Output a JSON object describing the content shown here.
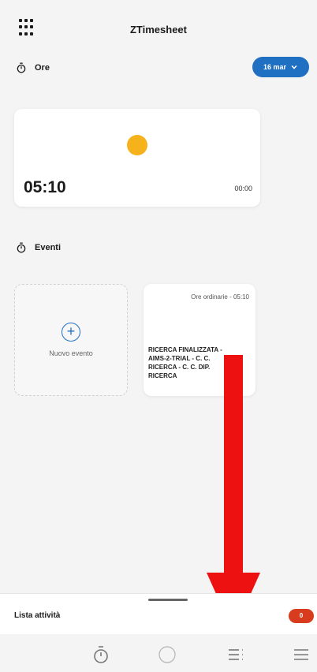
{
  "header": {
    "title": "ZTimesheet",
    "menu_icon": "grid-icon"
  },
  "hours_section": {
    "label": "Ore",
    "icon": "stopwatch-icon",
    "date_selector": {
      "label": "16 mar",
      "icon": "chevron-down-icon"
    }
  },
  "hours_card": {
    "total": "05:10",
    "secondary": "00:00",
    "indicator_color": "#f6b21b"
  },
  "events_section": {
    "label": "Eventi",
    "icon": "stopwatch-icon"
  },
  "new_event": {
    "label": "Nuovo evento",
    "icon": "plus-circle-icon"
  },
  "event_card": {
    "type": "Ore ordinarie - 05:10",
    "description": "RICERCA FINALIZZATA -\nAIMS-2-TRIAL - C. C.\nRICERCA - C. C. DIP.\nRICERCA"
  },
  "activity_sheet": {
    "label": "Lista attività",
    "count": "0"
  },
  "tabbar": {
    "items": [
      {
        "icon": "stopwatch-icon"
      },
      {
        "icon": "circle-icon"
      },
      {
        "icon": "list-icon"
      },
      {
        "icon": "menu-icon"
      }
    ]
  },
  "colors": {
    "accent": "#1f6fc3",
    "badge": "#d83c1e",
    "sun": "#f6b21b",
    "arrow": "#ee1111"
  }
}
